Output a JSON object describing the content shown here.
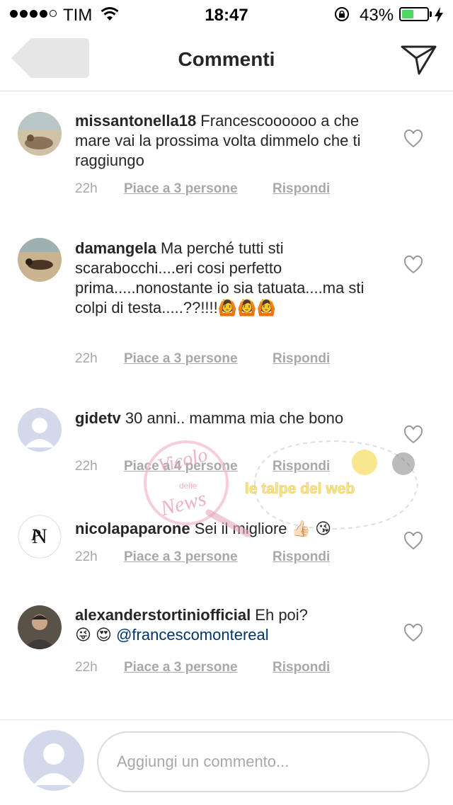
{
  "status_bar": {
    "carrier": "TIM",
    "time": "18:47",
    "battery_percent": "43%",
    "battery_level": 0.43,
    "icons": [
      "signal-dots-icon",
      "wifi-icon",
      "orientation-lock-icon",
      "battery-icon",
      "charging-bolt-icon"
    ]
  },
  "nav": {
    "title": "Commenti",
    "icons": [
      "back-icon",
      "send-icon"
    ]
  },
  "comments": [
    {
      "username": "missantonella18",
      "text": " Francescoooooo a che mare vai la prossima volta dimmelo che ti raggiungo",
      "time": "22h",
      "likes": "Piace a 3 persone",
      "reply": "Rispondi"
    },
    {
      "username": "damangela",
      "text": " Ma perché tutti sti scarabocchi....eri cosi perfetto prima.....nonostante io sia tatuata....ma sti colpi di testa.....??!!!!🙆🙆🙆",
      "time": "22h",
      "likes": "Piace a 3 persone",
      "reply": "Rispondi"
    },
    {
      "username": "gidetv",
      "text": " 30 anni.. mamma mia che bono",
      "time": "22h",
      "likes": "Piace a 4 persone",
      "reply": "Rispondi"
    },
    {
      "username": "nicolapaparone",
      "text": " Sei il migliore 👍🏻 😘",
      "time": "22h",
      "likes": "Piace a 3 persone",
      "reply": "Rispondi"
    },
    {
      "username": "alexanderstortiniofficial",
      "text": " Eh poi?",
      "text2": "😜 😍 ",
      "mention": "@francescomontereal",
      "time": "22h",
      "likes": "Piace a 3 persone",
      "reply": "Rispondi"
    }
  ],
  "watermarks": {
    "left": [
      "Vicolo",
      "delle",
      "News"
    ],
    "right": "le talpe del web"
  },
  "composer": {
    "placeholder": "Aggiungi un commento..."
  }
}
